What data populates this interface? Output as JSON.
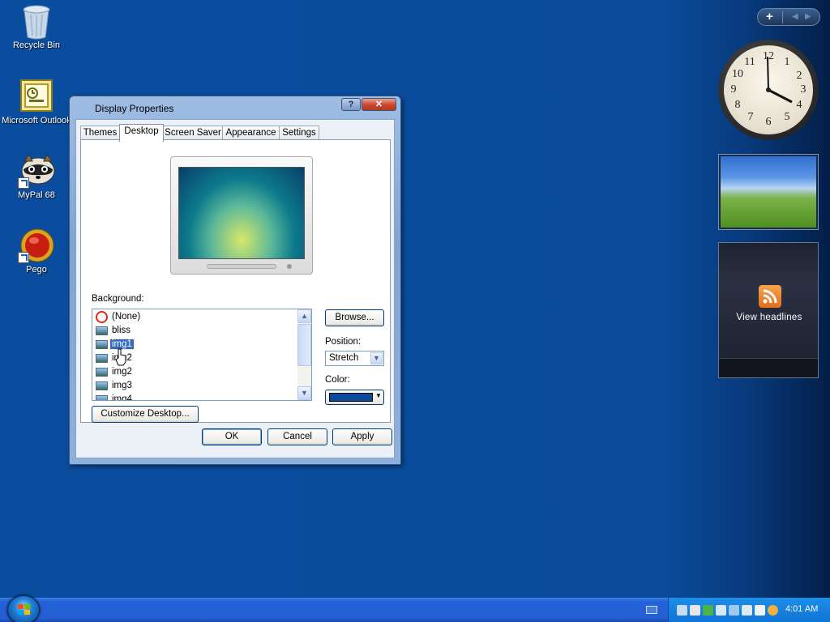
{
  "desktop": {
    "icons": [
      {
        "label": "Recycle Bin",
        "icon": "recycle-bin-icon"
      },
      {
        "label": "Microsoft Outlook",
        "icon": "outlook-icon"
      },
      {
        "label": "MyPal 68",
        "icon": "mypal-icon"
      },
      {
        "label": "Pego",
        "icon": "pego-icon"
      }
    ]
  },
  "gadgets": {
    "toolbar": {
      "add_label": "+"
    },
    "clock": {
      "numbers": [
        "12",
        "1",
        "2",
        "3",
        "4",
        "5",
        "6",
        "7",
        "8",
        "9",
        "10",
        "11"
      ],
      "time": "4:01"
    },
    "feed": {
      "label": "View headlines"
    }
  },
  "dialog": {
    "title": "Display Properties",
    "help_label": "?",
    "close_label": "✕",
    "tabs": [
      "Themes",
      "Desktop",
      "Screen Saver",
      "Appearance",
      "Settings"
    ],
    "active_tab": "Desktop",
    "background_label": "Background:",
    "backgrounds": [
      "(None)",
      "bliss",
      "img1",
      "img2",
      "img2",
      "img3",
      "img4"
    ],
    "selected_background": "img1",
    "browse_label": "Browse...",
    "position_label": "Position:",
    "position_value": "Stretch",
    "color_label": "Color:",
    "color_value": "#0a4b9c",
    "customize_label": "Customize Desktop...",
    "ok_label": "OK",
    "cancel_label": "Cancel",
    "apply_label": "Apply"
  },
  "taskbar": {
    "clock": "4:01 AM"
  },
  "colors": {
    "desktop_bg": "#0a4b9c",
    "selection": "#316ac5",
    "taskbar": "#245ed4"
  }
}
